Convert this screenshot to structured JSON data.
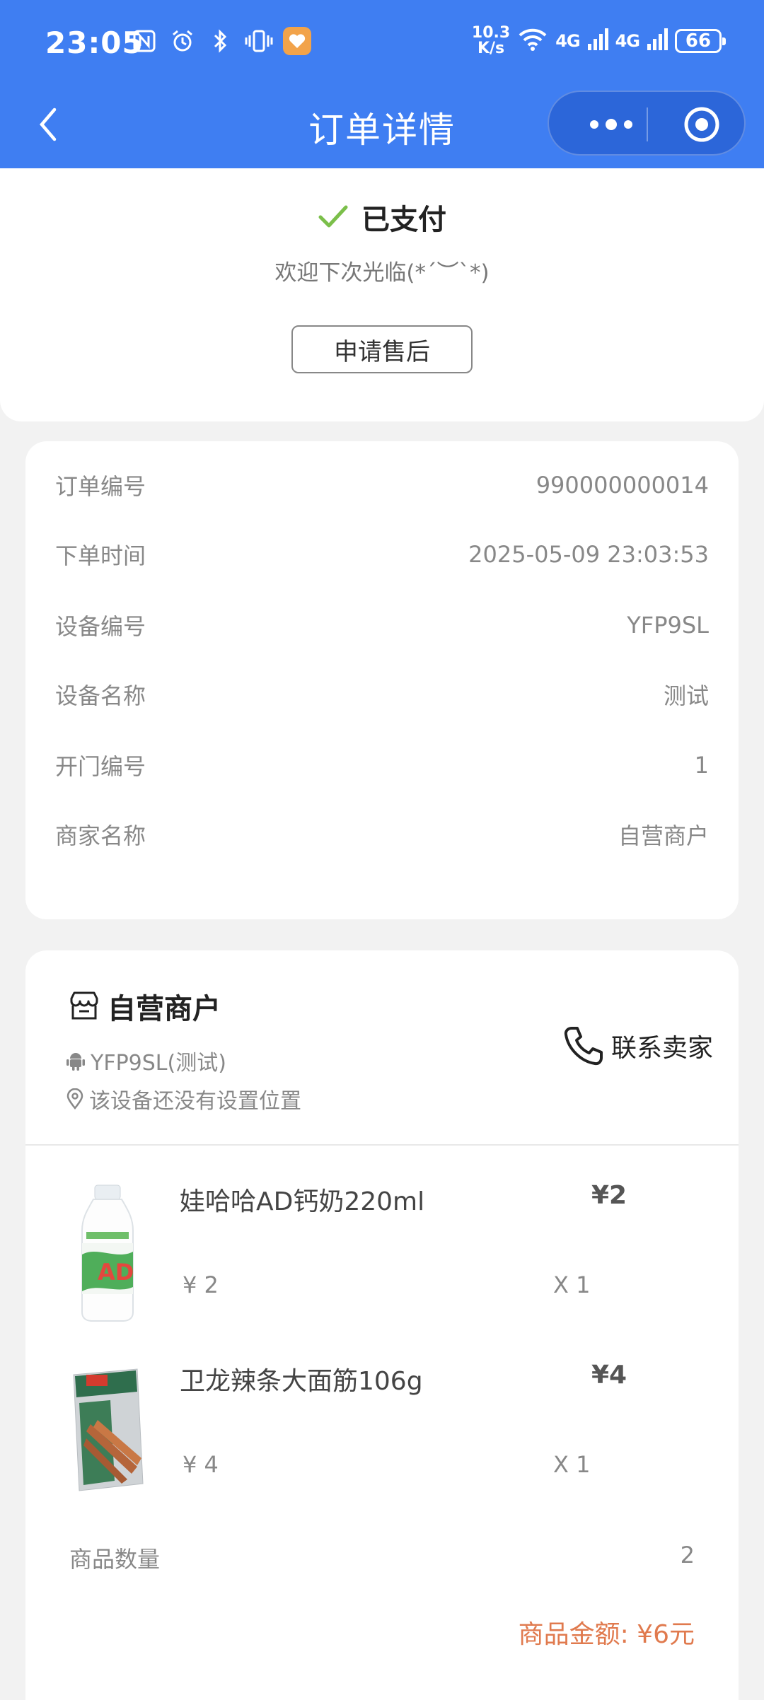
{
  "status_bar": {
    "time": "23:05",
    "net_speed_value": "10.3",
    "net_speed_unit": "K/s",
    "signal_1": "4G",
    "signal_2": "4G",
    "battery": "66"
  },
  "nav": {
    "title": "订单详情"
  },
  "payment": {
    "status": "已支付",
    "welcome": "欢迎下次光临(*´︶`*)",
    "after_sale_button": "申请售后",
    "status_color": "#7bbf4a"
  },
  "order_info": {
    "rows": [
      {
        "label": "订单编号",
        "value": "990000000014"
      },
      {
        "label": "下单时间",
        "value": "2025-05-09 23:03:53"
      },
      {
        "label": "设备编号",
        "value": "YFP9SL"
      },
      {
        "label": "设备名称",
        "value": "测试"
      },
      {
        "label": "开门编号",
        "value": "1"
      },
      {
        "label": "商家名称",
        "value": "自营商户"
      }
    ]
  },
  "merchant": {
    "name": "自营商户",
    "device": "YFP9SL(测试)",
    "location": "该设备还没有设置位置",
    "contact_label": "联系卖家"
  },
  "products": [
    {
      "name": "娃哈哈AD钙奶220ml",
      "total": "¥2",
      "unit_price": "¥ 2",
      "qty": "X 1"
    },
    {
      "name": "卫龙辣条大面筋106g",
      "total": "¥4",
      "unit_price": "¥ 4",
      "qty": "X 1"
    }
  ],
  "summary": {
    "count_label": "商品数量",
    "count_value": "2",
    "amount_text": "商品金额: ¥6元",
    "amount_color": "#e07a4e"
  },
  "colors": {
    "brand_blue": "#3f7ef2"
  }
}
